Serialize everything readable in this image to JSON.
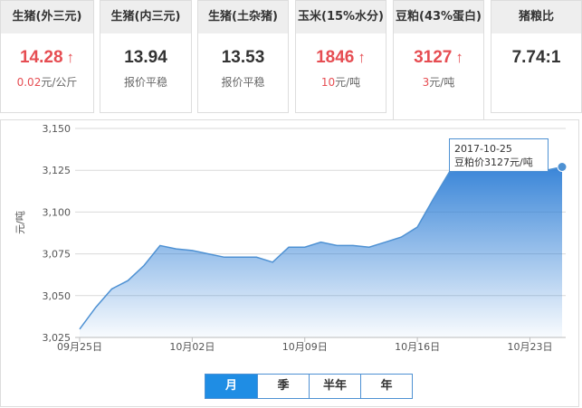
{
  "cards": [
    {
      "title": "生猪(外三元)",
      "price": "14.28",
      "trend": "up",
      "delta": "0.02",
      "unit": "元/公斤",
      "note": ""
    },
    {
      "title": "生猪(内三元)",
      "price": "13.94",
      "trend": "flat",
      "delta": "",
      "unit": "",
      "note": "报价平稳"
    },
    {
      "title": "生猪(土杂猪)",
      "price": "13.53",
      "trend": "flat",
      "delta": "",
      "unit": "",
      "note": "报价平稳"
    },
    {
      "title": "玉米(15%水分)",
      "price": "1846",
      "trend": "up",
      "delta": "10",
      "unit": "元/吨",
      "note": ""
    },
    {
      "title": "豆粕(43%蛋白)",
      "price": "3127",
      "trend": "up",
      "delta": "3",
      "unit": "元/吨",
      "note": ""
    },
    {
      "title": "猪粮比",
      "price": "7.74:1",
      "trend": "flat",
      "delta": "",
      "unit": "",
      "note": ""
    }
  ],
  "arrow_glyph": "↑",
  "tooltip": {
    "date": "2017-10-25",
    "text": "豆粕价3127元/吨"
  },
  "tabs": [
    {
      "label": "月",
      "active": true
    },
    {
      "label": "季",
      "active": false
    },
    {
      "label": "半年",
      "active": false
    },
    {
      "label": "年",
      "active": false
    }
  ],
  "colors": {
    "accent": "#1f8de4",
    "up": "#e64d52",
    "line": "#4e91d3"
  },
  "chart_data": {
    "type": "area",
    "title": "",
    "xlabel": "",
    "ylabel": "元/吨",
    "ylim": [
      3025,
      3150
    ],
    "yticks": [
      3025,
      3050,
      3075,
      3100,
      3125,
      3150
    ],
    "ytick_labels": [
      "3,025",
      "3,050",
      "3,075",
      "3,100",
      "3,125",
      "3,150"
    ],
    "xtick_labels": [
      "09月25日",
      "10月02日",
      "10月09日",
      "10月16日",
      "10月23日"
    ],
    "x": [
      "09-25",
      "09-26",
      "09-27",
      "09-28",
      "09-29",
      "09-30",
      "10-01",
      "10-02",
      "10-03",
      "10-04",
      "10-05",
      "10-06",
      "10-07",
      "10-08",
      "10-09",
      "10-10",
      "10-11",
      "10-12",
      "10-13",
      "10-14",
      "10-15",
      "10-16",
      "10-17",
      "10-18",
      "10-19",
      "10-20",
      "10-21",
      "10-22",
      "10-23",
      "10-24",
      "10-25"
    ],
    "values": [
      3030,
      3043,
      3054,
      3059,
      3068,
      3080,
      3078,
      3077,
      3075,
      3073,
      3073,
      3073,
      3070,
      3079,
      3079,
      3082,
      3080,
      3080,
      3079,
      3082,
      3085,
      3091,
      3108,
      3124,
      3125,
      3125,
      3125,
      3125,
      3125,
      3125,
      3127
    ],
    "grid": true,
    "legend": "none"
  }
}
